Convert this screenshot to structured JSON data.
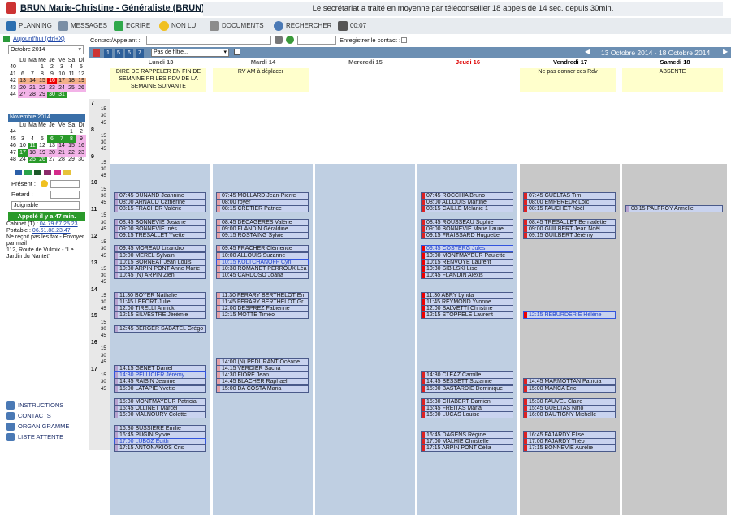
{
  "header": {
    "title": "BRUN Marie-Christine - Généraliste (BRUN)",
    "message": "Le secrétariat a traité en moyenne par téléconseiller 18 appels de 14 sec. depuis 30min."
  },
  "toolbar": {
    "planning": "PLANNING",
    "messages": "MESSAGES",
    "ecrire": "ECRIRE",
    "non_lu": "NON LU",
    "documents": "DOCUMENTS",
    "rechercher": "RECHERCHER",
    "time": "00:07"
  },
  "search": {
    "contact_label": "Contact/Appelant :",
    "register_label": "Enregistrer le contact :"
  },
  "sidebar": {
    "today_link": "Aujourd'hui (ctrl+X)",
    "month_select": "Octobre 2014",
    "nov_header": "Novembre 2014",
    "present_label": "Présent :",
    "retard_label": "Retard :",
    "joignable": "Joignable",
    "appele": "Appelé il y a 47 min.",
    "cabinet_label": "Cabinet (T) :",
    "cabinet_phone": "04.79.67.25.23",
    "portable_label": "Portable :",
    "portable_phone": "06.61.88.23.47",
    "fax_note": "Ne reçoit pas les fax - Envoyer par mail",
    "address": "112, Route de Vulmix - \"Le Jardin du Nantet\"",
    "links": [
      {
        "label": "INSTRUCTIONS",
        "icon": "info-icon"
      },
      {
        "label": "CONTACTS",
        "icon": "contacts-icon"
      },
      {
        "label": "ORGANIGRAMME",
        "icon": "org-icon"
      },
      {
        "label": "LISTE ATTENTE",
        "icon": "list-icon"
      }
    ]
  },
  "calendar": {
    "weekday_headers": [
      "Lu",
      "Ma",
      "Me",
      "Je",
      "Ve",
      "Sa",
      "Di"
    ],
    "oct_rows": [
      [
        "40",
        "",
        "",
        "1",
        "2",
        "3",
        "4",
        "5"
      ],
      [
        "41",
        "6",
        "7",
        "8",
        "9",
        "10",
        "11",
        "12"
      ],
      [
        "42",
        "13",
        "14",
        "15",
        "16",
        "17",
        "18",
        "19"
      ],
      [
        "43",
        "20",
        "21",
        "22",
        "23",
        "24",
        "25",
        "26"
      ],
      [
        "44",
        "27",
        "28",
        "29",
        "30",
        "31",
        "",
        ""
      ]
    ],
    "nov_rows": [
      [
        "44",
        "",
        "",
        "",
        "",
        "",
        "1",
        "2"
      ],
      [
        "45",
        "3",
        "4",
        "5",
        "6",
        "7",
        "8",
        "9"
      ],
      [
        "46",
        "10",
        "11",
        "12",
        "13",
        "14",
        "15",
        "16"
      ],
      [
        "47",
        "17",
        "18",
        "19",
        "20",
        "21",
        "22",
        "23"
      ],
      [
        "48",
        "24",
        "25",
        "26",
        "27",
        "28",
        "29",
        "30"
      ]
    ]
  },
  "planning": {
    "view_buttons": [
      "1",
      "5",
      "6",
      "7"
    ],
    "filter": "Pas de filtre...",
    "range": "13 Octobre 2014 - 18 Octobre 2014",
    "days": [
      {
        "label": "Lundi 13",
        "color": "#555",
        "note": "DIRE DE RAPPELER EN FIN DE SEMAINE PR LES RDV DE LA SEMAINE SUIVANTE"
      },
      {
        "label": "Mardi 14",
        "color": "#555",
        "note": "RV AM à déplacer"
      },
      {
        "label": "Mercredi 15",
        "color": "#555",
        "note": ""
      },
      {
        "label": "Jeudi 16",
        "color": "#d00",
        "note": ""
      },
      {
        "label": "Vendredi 17",
        "color": "#000",
        "note": "Ne pas donner ces Rdv"
      },
      {
        "label": "Samedi 18",
        "color": "#000",
        "note": "ABSENTE"
      }
    ],
    "hours": [
      "7",
      "8",
      "9",
      "10",
      "11",
      "12",
      "13",
      "14",
      "15",
      "16",
      "17"
    ],
    "appointments": [
      {
        "d": 0,
        "r": 4,
        "t": "07:45 DUNAND Jeannine",
        "s": 0
      },
      {
        "d": 0,
        "r": 5,
        "t": "08:00 ARNAUD Catherine",
        "s": 0
      },
      {
        "d": 0,
        "r": 6,
        "t": "08:15 FRACHER Valérie",
        "s": 0
      },
      {
        "d": 0,
        "r": 8,
        "t": "08:45 BONNEVIE Josiane",
        "s": 0
      },
      {
        "d": 0,
        "r": 9,
        "t": "09:00 BONNEVIE Inès",
        "s": 0
      },
      {
        "d": 0,
        "r": 10,
        "t": "09:15 TRESALLET Yvette",
        "s": 0
      },
      {
        "d": 0,
        "r": 12,
        "t": "09:45 MOREAU Lizandro",
        "s": 0
      },
      {
        "d": 0,
        "r": 13,
        "t": "10:00 MEREL Sylvain",
        "s": 0
      },
      {
        "d": 0,
        "r": 14,
        "t": "10:15 BORNEAT Jean Louis",
        "s": 0
      },
      {
        "d": 0,
        "r": 15,
        "t": "10:30 ARPIN PONT Anne Marie",
        "s": 0
      },
      {
        "d": 0,
        "r": 16,
        "t": "10:45 (N) ARPIN Zien",
        "s": 0
      },
      {
        "d": 0,
        "r": 19,
        "t": "11:30 BOYER Nathalie",
        "s": 0
      },
      {
        "d": 0,
        "r": 20,
        "t": "11:45 LEFORT Julie",
        "s": 0
      },
      {
        "d": 0,
        "r": 21,
        "t": "12:00 TIRELLI Annick",
        "s": 0
      },
      {
        "d": 0,
        "r": 22,
        "t": "12:15 SILVESTRE Jérémie",
        "s": 0
      },
      {
        "d": 0,
        "r": 24,
        "t": "12:45 BERGER SABATEL Grégo",
        "s": 0
      },
      {
        "d": 0,
        "r": 30,
        "t": "14:15 GENET Daniel",
        "s": 0
      },
      {
        "d": 0,
        "r": 31,
        "t": "14:30 PELLICIER Jérémy",
        "s": 1
      },
      {
        "d": 0,
        "r": 32,
        "t": "14:45 RAISIN Jeanine",
        "s": 0
      },
      {
        "d": 0,
        "r": 33,
        "t": "15:00 LATAPIE Yvette",
        "s": 0
      },
      {
        "d": 0,
        "r": 35,
        "t": "15:30 MONTMAYEUR Patricia",
        "s": 0
      },
      {
        "d": 0,
        "r": 36,
        "t": "15:45 OLLINET Marcel",
        "s": 0
      },
      {
        "d": 0,
        "r": 37,
        "t": "16:00 MALNOURY Colette",
        "s": 0
      },
      {
        "d": 0,
        "r": 39,
        "t": "16:30 BUSSIERE Emilie",
        "s": 0
      },
      {
        "d": 0,
        "r": 40,
        "t": "16:45 PUGIN Sylvie",
        "s": 0
      },
      {
        "d": 0,
        "r": 41,
        "t": "17:00 LUBOZ Edith",
        "s": 1
      },
      {
        "d": 0,
        "r": 42,
        "t": "17:15 ANTONAKIOS Cris",
        "s": 0
      },
      {
        "d": 1,
        "r": 4,
        "t": "07:45 MOLLARD Jean-Pierre",
        "s": 0
      },
      {
        "d": 1,
        "r": 5,
        "t": "08:00 royer",
        "s": 0
      },
      {
        "d": 1,
        "r": 6,
        "t": "08:15 CRETIER Patrice",
        "s": 0
      },
      {
        "d": 1,
        "r": 8,
        "t": "08:45 DECAGERES Valérie",
        "s": 0
      },
      {
        "d": 1,
        "r": 9,
        "t": "09:00 FLANDIN Géraldine",
        "s": 0
      },
      {
        "d": 1,
        "r": 10,
        "t": "09:15 ROSTAING Sylvie",
        "s": 0
      },
      {
        "d": 1,
        "r": 12,
        "t": "09:45 FRACHER Clémence",
        "s": 0
      },
      {
        "d": 1,
        "r": 13,
        "t": "10:00 ALLOUIS Suzanne",
        "s": 0
      },
      {
        "d": 1,
        "r": 14,
        "t": "10:15 KOLTCHANOFF Cyril",
        "s": 1
      },
      {
        "d": 1,
        "r": 15,
        "t": "10:30 ROMANET PERROUX Léa",
        "s": 0
      },
      {
        "d": 1,
        "r": 16,
        "t": "10:45 CARDOSO Joana",
        "s": 0
      },
      {
        "d": 1,
        "r": 19,
        "t": "11:30 FERARY BERTHELOT Em",
        "s": 0
      },
      {
        "d": 1,
        "r": 20,
        "t": "11:45 FERARY BERTHELOT Gr",
        "s": 0
      },
      {
        "d": 1,
        "r": 21,
        "t": "12:00 DESPREZ Fabienne",
        "s": 0
      },
      {
        "d": 1,
        "r": 22,
        "t": "12:15 MOTTE Timéo",
        "s": 0
      },
      {
        "d": 1,
        "r": 29,
        "t": "14:00 (N) PEDURANT Océane",
        "s": 0
      },
      {
        "d": 1,
        "r": 30,
        "t": "14:15 VERDIER Sacha",
        "s": 0
      },
      {
        "d": 1,
        "r": 31,
        "t": "14:30 FIORE Jean",
        "s": 0
      },
      {
        "d": 1,
        "r": 32,
        "t": "14:45 BLACHER Raphael",
        "s": 0
      },
      {
        "d": 1,
        "r": 33,
        "t": "15:00 DA COSTA Maria",
        "s": 0
      },
      {
        "d": 3,
        "r": 4,
        "t": "07:45 ROCCHIA Bruno",
        "s": 0
      },
      {
        "d": 3,
        "r": 5,
        "t": "08:00 ALLOUIS Martine",
        "s": 0
      },
      {
        "d": 3,
        "r": 6,
        "t": "08:15 CAILLE Mélanie 1",
        "s": 0
      },
      {
        "d": 3,
        "r": 8,
        "t": "08:45 ROUSSEAU Sophie",
        "s": 0
      },
      {
        "d": 3,
        "r": 9,
        "t": "09:00 BONNEVIE Marie Laure",
        "s": 0
      },
      {
        "d": 3,
        "r": 10,
        "t": "09:15 FRAISSARD Huguette",
        "s": 0
      },
      {
        "d": 3,
        "r": 12,
        "t": "09:45 COSTERG Jules",
        "s": 1
      },
      {
        "d": 3,
        "r": 13,
        "t": "10:00 MONTMAYEUR Paulette",
        "s": 0
      },
      {
        "d": 3,
        "r": 14,
        "t": "10:15 RENVOYE Laurent",
        "s": 0
      },
      {
        "d": 3,
        "r": 15,
        "t": "10:30 SIBILSKI Lise",
        "s": 0
      },
      {
        "d": 3,
        "r": 16,
        "t": "10:45 FLANDIN Alexis",
        "s": 0
      },
      {
        "d": 3,
        "r": 19,
        "t": "11:30 ABRY Lynda",
        "s": 0
      },
      {
        "d": 3,
        "r": 20,
        "t": "11:45 REYMOND Yvonne",
        "s": 0
      },
      {
        "d": 3,
        "r": 21,
        "t": "12:00 SALVETTI Christine",
        "s": 0
      },
      {
        "d": 3,
        "r": 22,
        "t": "12:15 STOPPELE Laurent",
        "s": 0
      },
      {
        "d": 3,
        "r": 31,
        "t": "14:30 CLEAZ Camille",
        "s": 0
      },
      {
        "d": 3,
        "r": 32,
        "t": "14:45 BESSETT Suzanne",
        "s": 0
      },
      {
        "d": 3,
        "r": 33,
        "t": "15:00 BASTARDIE Dominique",
        "s": 0
      },
      {
        "d": 3,
        "r": 35,
        "t": "15:30 CHABERT Damien",
        "s": 0
      },
      {
        "d": 3,
        "r": 36,
        "t": "15:45 FREITAS Maria",
        "s": 0
      },
      {
        "d": 3,
        "r": 37,
        "t": "16:00 LUCAS Louise",
        "s": 0
      },
      {
        "d": 3,
        "r": 40,
        "t": "16:45 DAGENS Régine",
        "s": 0
      },
      {
        "d": 3,
        "r": 41,
        "t": "17:00 MALHIE Christelle",
        "s": 0
      },
      {
        "d": 3,
        "r": 42,
        "t": "17:15 ARPIN PONT Célia",
        "s": 0
      },
      {
        "d": 4,
        "r": 4,
        "t": "07:45 GUELTAS Tim",
        "s": 0
      },
      {
        "d": 4,
        "r": 5,
        "t": "08:00 EMPEREUR Loïc",
        "s": 0
      },
      {
        "d": 4,
        "r": 6,
        "t": "08:15 FAUCHET Noël",
        "s": 0
      },
      {
        "d": 4,
        "r": 8,
        "t": "08:45 TRESALLET Bernadette",
        "s": 0
      },
      {
        "d": 4,
        "r": 9,
        "t": "09:00 GUILBERT Jean Noël",
        "s": 0
      },
      {
        "d": 4,
        "r": 10,
        "t": "09:15 GUILBERT Jérémy",
        "s": 0
      },
      {
        "d": 4,
        "r": 22,
        "t": "12:15 REBURDERIE Hélène",
        "s": 1
      },
      {
        "d": 4,
        "r": 32,
        "t": "14:45 MARMOTTAN Patricia",
        "s": 0
      },
      {
        "d": 4,
        "r": 33,
        "t": "15:00 MANCA Eric",
        "s": 0
      },
      {
        "d": 4,
        "r": 35,
        "t": "15:30 FAUVEL Claire",
        "s": 0
      },
      {
        "d": 4,
        "r": 36,
        "t": "15:45 GUELTAS Nino",
        "s": 0
      },
      {
        "d": 4,
        "r": 37,
        "t": "16:00 DAUTIGNY Michelle",
        "s": 0
      },
      {
        "d": 4,
        "r": 40,
        "t": "16:45 FAJARDY Elise",
        "s": 0
      },
      {
        "d": 4,
        "r": 41,
        "t": "17:00 FAJARDY Théo",
        "s": 0
      },
      {
        "d": 4,
        "r": 42,
        "t": "17:15 BONNEVIE Aurélie",
        "s": 0
      },
      {
        "d": 5,
        "r": 6,
        "t": "08:15 PALFROY Armelle",
        "s": 0
      }
    ]
  },
  "colors": {
    "accent": "#3a6fa8",
    "header_band": "#6c8fb3",
    "slot_blue": "#c9d3ef",
    "unavailable": "#bfbfbf",
    "weekend": "#c8c8c8",
    "mercredi": "#bfcfe2"
  }
}
